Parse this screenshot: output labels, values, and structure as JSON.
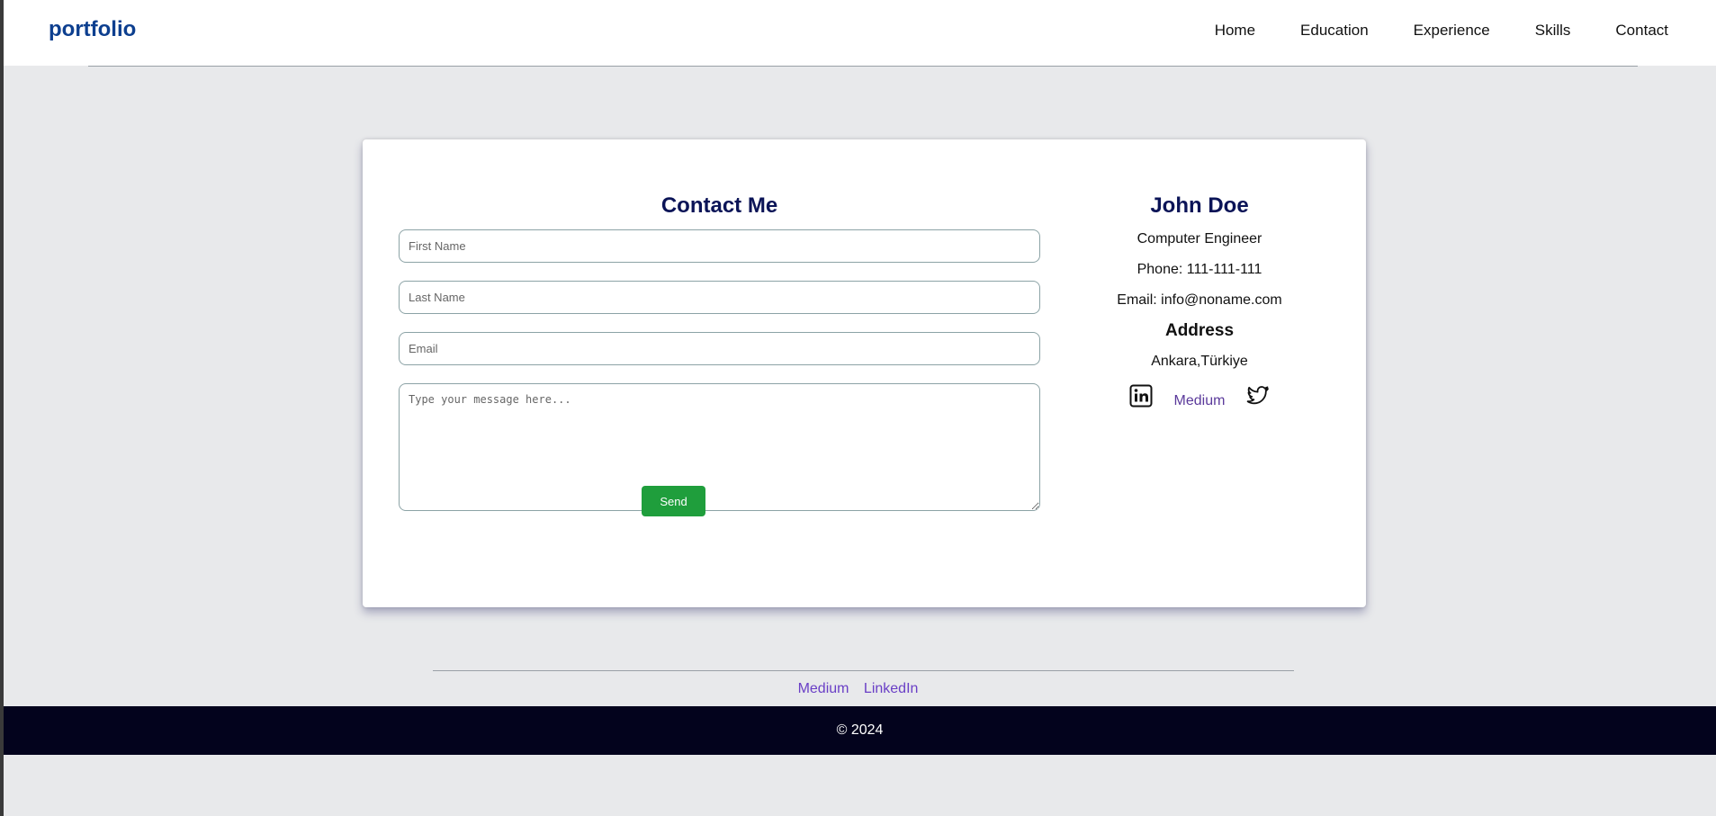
{
  "header": {
    "brand": "portfolio",
    "nav": [
      "Home",
      "Education",
      "Experience",
      "Skills",
      "Contact"
    ]
  },
  "contact_form": {
    "title": "Contact Me",
    "first_name_placeholder": "First Name",
    "last_name_placeholder": "Last Name",
    "email_placeholder": "Email",
    "message_placeholder": "Type your message here...",
    "send_label": "Send",
    "send_color": "#1f9e3c"
  },
  "profile": {
    "name": "John Doe",
    "title": "Computer Engineer",
    "phone": "Phone: 111-111-111",
    "email": "Email: info@noname.com",
    "address_heading": "Address",
    "address": "Ankara,Türkiye",
    "social": {
      "linkedin_icon": "linkedin-icon",
      "medium_alt": "Medium",
      "twitter_icon": "twitter-icon"
    }
  },
  "footer": {
    "links": [
      "Medium",
      "LinkedIn"
    ],
    "copyright": "© 2024"
  },
  "colors": {
    "brand": "#0d3f8f",
    "heading": "#0b1457",
    "footer_bg": "#03031d",
    "link": "#6a3fc6"
  }
}
